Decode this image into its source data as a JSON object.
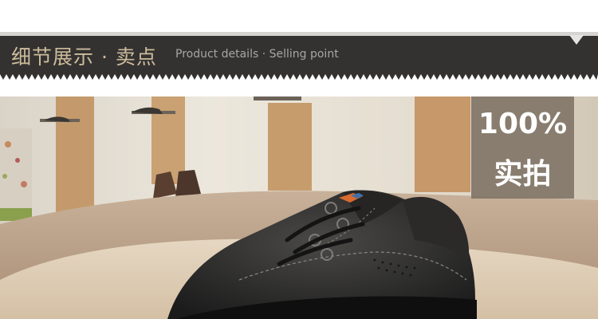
{
  "section_header": {
    "title_cn": "细节展示 · 卖点",
    "title_en": "Product details · Selling point"
  },
  "badge": {
    "line1": "100%",
    "line2": "实拍"
  },
  "colors": {
    "banner_bg": "#333231",
    "title_cn": "#cdbb9b",
    "title_en": "#a8a6a2",
    "badge_bg": "#827668"
  },
  "icons": [
    "down-triangle-notch"
  ]
}
